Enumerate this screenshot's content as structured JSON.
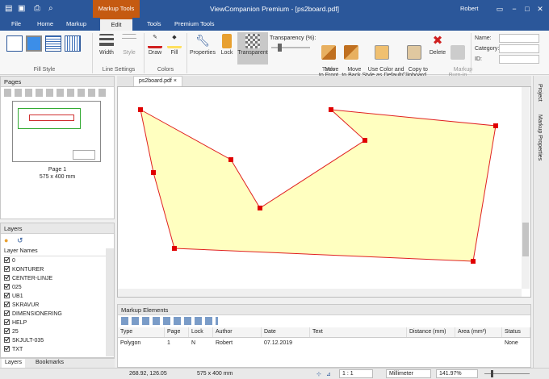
{
  "app": {
    "title": "ViewCompanion Premium - [ps2board.pdf]",
    "context_tab": "Markup Tools",
    "user": "Robert"
  },
  "tabs": [
    "File",
    "Home",
    "Markup",
    "Edit",
    "Tools",
    "Premium Tools"
  ],
  "active_tab": "Edit",
  "ribbon": {
    "groups": {
      "fill_style": "Fill Style",
      "line_settings": "Line Settings",
      "colors": "Colors",
      "tools": "Tools"
    },
    "buttons": {
      "width": "Width",
      "style": "Style",
      "draw": "Draw",
      "fill": "Fill",
      "properties": "Properties",
      "lock": "Lock",
      "transparent": "Transparent",
      "move_front": "Move\nto Front",
      "move_back": "Move\nto Back",
      "use_color": "Use Color and\nStyle as Default",
      "copy_clip": "Copy to\nClipboard",
      "delete": "Delete",
      "burn_in": "Markup\nBurn-in"
    },
    "transparency_label": "Transparency (%):",
    "fields": {
      "name": "Name:",
      "category": "Category:",
      "id": "ID:"
    }
  },
  "pages_panel": {
    "title": "Pages",
    "thumb_label": "Page 1",
    "thumb_size": "575 x 400 mm"
  },
  "layers_panel": {
    "title": "Layers",
    "column": "Layer Names",
    "layers": [
      "0",
      "KONTURER",
      "CENTER-LINJE",
      "025",
      "UB1",
      "SKRAVUR",
      "DIMENSIONERING",
      "HELP",
      "25",
      "SKJULT-035",
      "TXT"
    ],
    "bottom_tabs": [
      "Layers",
      "Bookmarks"
    ]
  },
  "document_tab": "ps2board.pdf",
  "side_tabs": [
    "Project",
    "Markup Properties"
  ],
  "markup_elements": {
    "title": "Markup Elements",
    "columns": [
      "Type",
      "Page",
      "Lock",
      "Author",
      "Date",
      "Text",
      "Distance (mm)",
      "Area (mm²)",
      "Status"
    ],
    "rows": [
      [
        "Polygon",
        "1",
        "N",
        "Robert",
        "07.12.2019",
        "",
        "",
        "",
        "None"
      ]
    ]
  },
  "status": {
    "coords": "268.92, 126.05",
    "page_size": "575 x 400 mm",
    "scale": "1 : 1",
    "units": "Millimeter",
    "zoom": "141.97%"
  },
  "colors": {
    "accent": "#2b579a",
    "context": "#c55a11",
    "polygon_fill": "#ffffc0",
    "polygon_stroke": "#e02020",
    "handle": "#e00000"
  }
}
